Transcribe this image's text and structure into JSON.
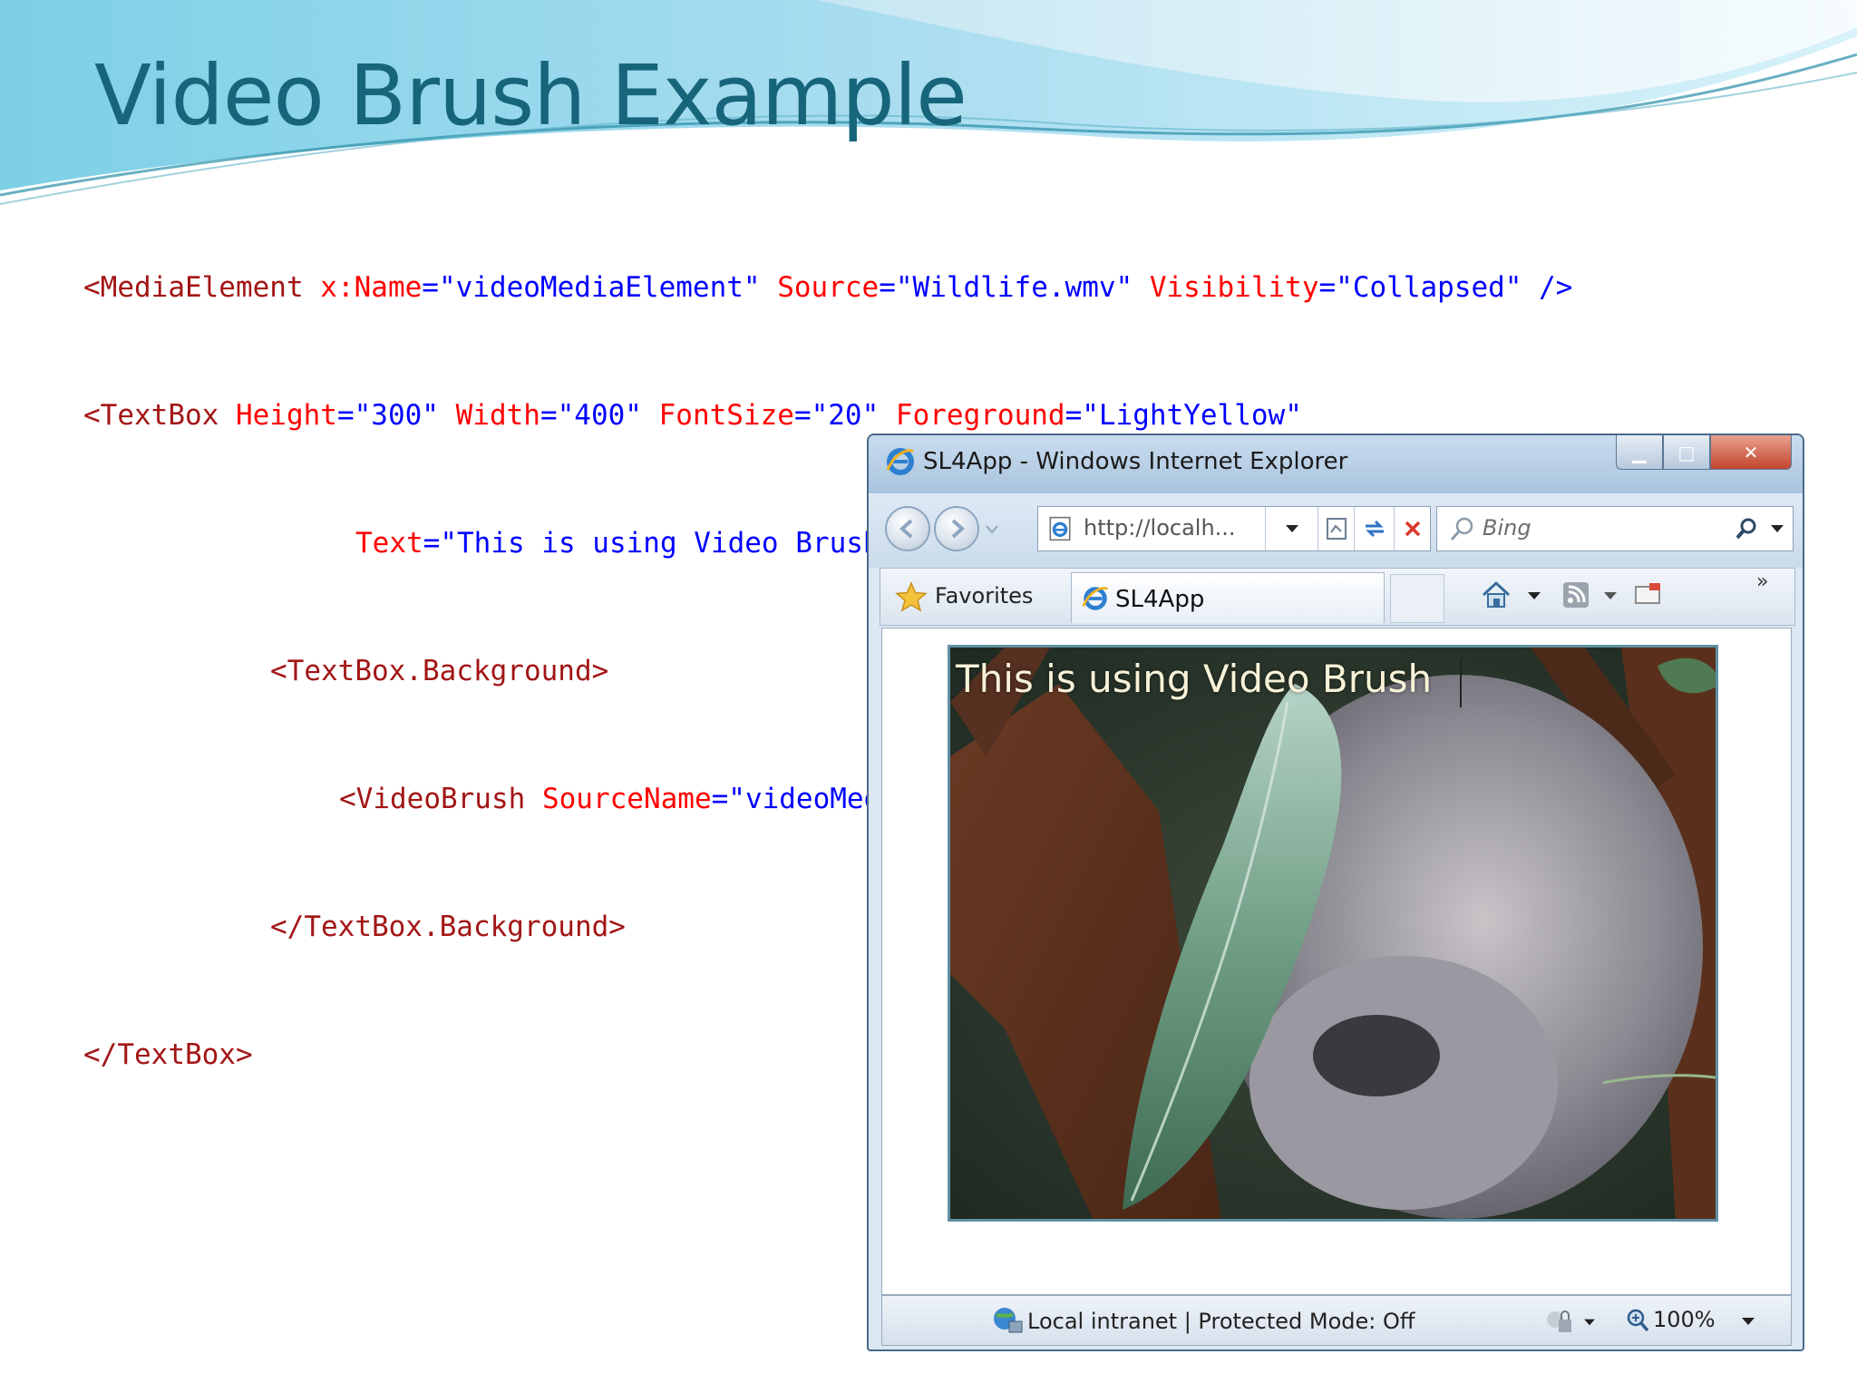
{
  "slide": {
    "title": "Video Brush Example"
  },
  "code": {
    "line1": {
      "t1": "<MediaElement ",
      "a1": "x:Name",
      "eq1": "=",
      "v1": "\"videoMediaElement\"",
      "a2": " Source",
      "eq2": "=",
      "v2": "\"Wildlife.wmv\"",
      "a3": " Visibility",
      "eq3": "=",
      "v3": "\"Collapsed\"",
      "end": " />"
    },
    "line2": {
      "t1": "<TextBox ",
      "a1": "Height",
      "eq1": "=",
      "v1": "\"300\"",
      "a2": " Width",
      "eq2": "=",
      "v2": "\"400\"",
      "a3": " FontSize",
      "eq3": "=",
      "v3": "\"20\"",
      "a4": " Foreground",
      "eq4": "=",
      "v4": "\"LightYellow\""
    },
    "line3": {
      "a1": "Text",
      "eq1": "=",
      "v1": "\"This is using Video Brush\"",
      "end": ">"
    },
    "line4": {
      "t1": "<TextBox.Background>"
    },
    "line5": {
      "t1": "<VideoBrush ",
      "a1": "SourceName",
      "eq1": "=",
      "v1": "\"videoMediaElement\"",
      "end": " />"
    },
    "line6": {
      "t1": "</TextBox.Background>"
    },
    "line7": {
      "t1": "</TextBox>"
    }
  },
  "browser": {
    "window_title": "SL4App - Windows Internet Explorer",
    "address": "http://localh...",
    "search_placeholder": "Bing",
    "favorites_label": "Favorites",
    "tab_label": "SL4App",
    "video_text": "This is using Video Brush",
    "status_text": "Local intranet | Protected Mode: Off",
    "zoom_label": "100%",
    "more_glyph": "»"
  },
  "colors": {
    "title": "#17657a",
    "code_tag": "#a31515",
    "code_attr": "#ff0000",
    "code_value": "#0000ff"
  }
}
